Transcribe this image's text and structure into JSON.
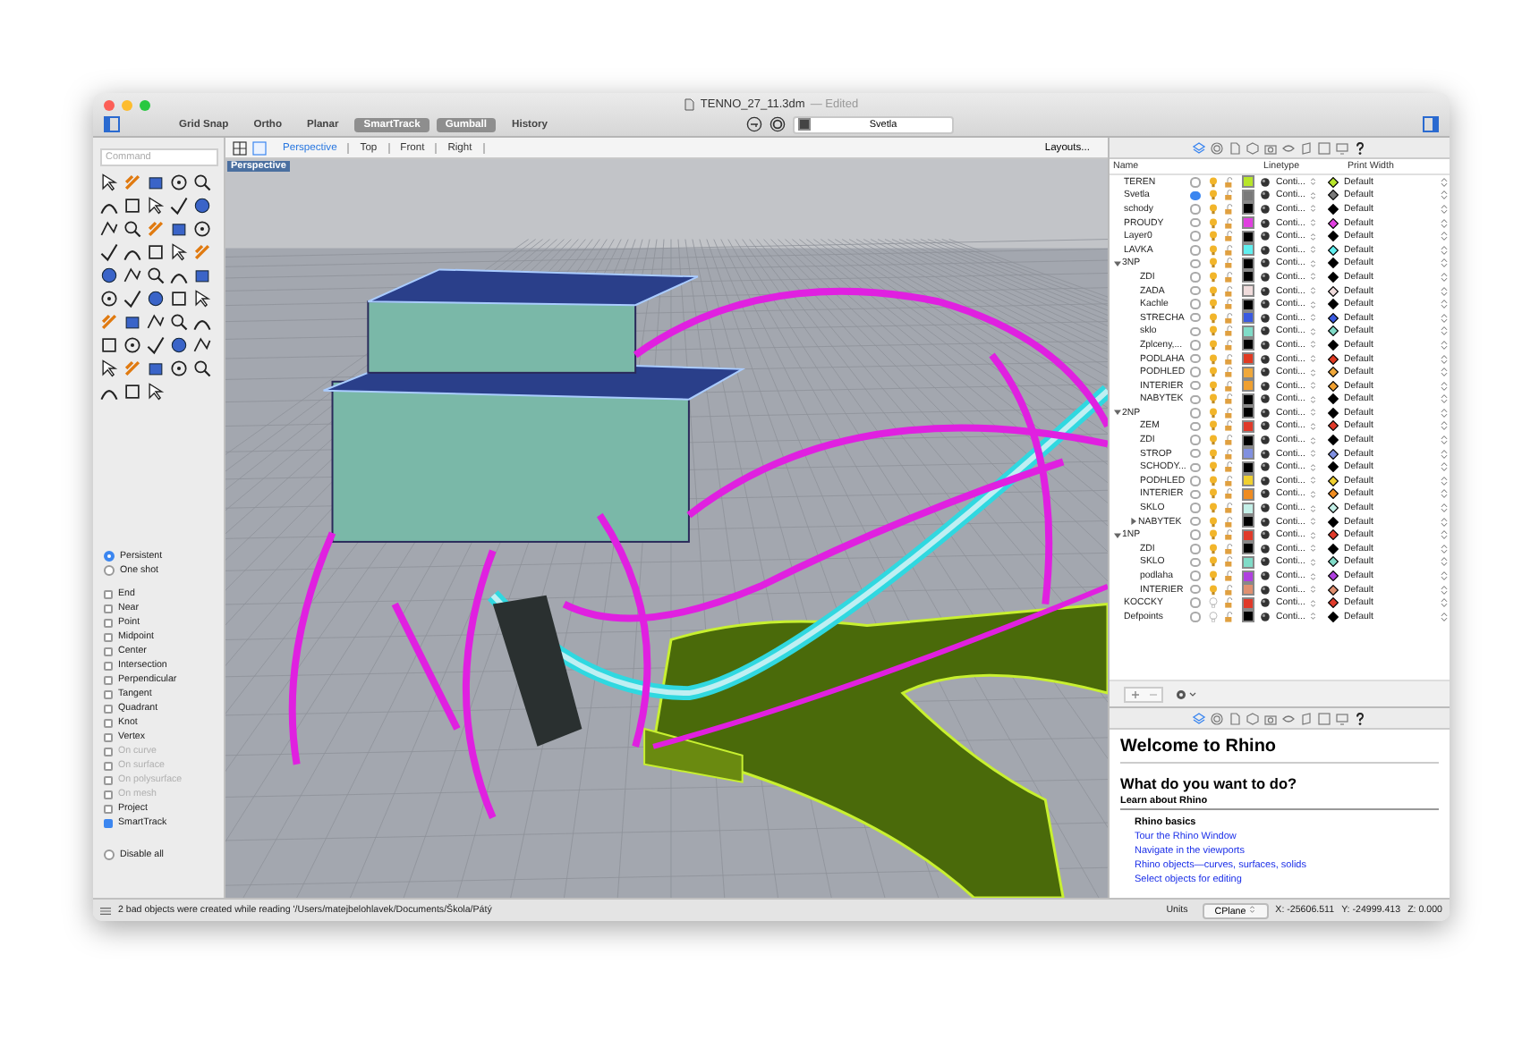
{
  "window": {
    "title": "TENNO_27_11.3dm",
    "subtitle": "— Edited"
  },
  "toolbar": {
    "toggles": [
      {
        "label": "Grid Snap",
        "on": false
      },
      {
        "label": "Ortho",
        "on": false
      },
      {
        "label": "Planar",
        "on": false
      },
      {
        "label": "SmartTrack",
        "on": true
      },
      {
        "label": "Gumball",
        "on": true
      },
      {
        "label": "History",
        "on": false
      }
    ],
    "layer_dropdown": "Svetla"
  },
  "viewport_tabs": {
    "tabs": [
      {
        "label": "Perspective",
        "selected": true
      },
      {
        "label": "Top",
        "selected": false
      },
      {
        "label": "Front",
        "selected": false
      },
      {
        "label": "Right",
        "selected": false
      }
    ],
    "layouts_button": "Layouts..."
  },
  "viewport": {
    "label": "Perspective"
  },
  "command": {
    "placeholder": "Command"
  },
  "snap_mode": [
    {
      "label": "Persistent",
      "selected": true
    },
    {
      "label": "One shot",
      "selected": false
    }
  ],
  "osnaps": [
    {
      "label": "End",
      "checked": false,
      "disabled": false
    },
    {
      "label": "Near",
      "checked": false,
      "disabled": false
    },
    {
      "label": "Point",
      "checked": false,
      "disabled": false
    },
    {
      "label": "Midpoint",
      "checked": false,
      "disabled": false
    },
    {
      "label": "Center",
      "checked": false,
      "disabled": false
    },
    {
      "label": "Intersection",
      "checked": false,
      "disabled": false
    },
    {
      "label": "Perpendicular",
      "checked": false,
      "disabled": false
    },
    {
      "label": "Tangent",
      "checked": false,
      "disabled": false
    },
    {
      "label": "Quadrant",
      "checked": false,
      "disabled": false
    },
    {
      "label": "Knot",
      "checked": false,
      "disabled": false
    },
    {
      "label": "Vertex",
      "checked": false,
      "disabled": false
    },
    {
      "label": "On curve",
      "checked": false,
      "disabled": true
    },
    {
      "label": "On surface",
      "checked": false,
      "disabled": true
    },
    {
      "label": "On polysurface",
      "checked": false,
      "disabled": true
    },
    {
      "label": "On mesh",
      "checked": false,
      "disabled": true
    },
    {
      "label": "Project",
      "checked": false,
      "disabled": false
    },
    {
      "label": "SmartTrack",
      "checked": true,
      "disabled": false
    }
  ],
  "disable_all": {
    "label": "Disable all",
    "checked": false
  },
  "layers": {
    "name_header": "Name",
    "linetype_header": "Linetype",
    "print_width_header": "Print Width",
    "items": [
      {
        "name": "TEREN",
        "current": false,
        "visible": true,
        "color": "#b8e62a",
        "linetype": "Conti...",
        "print_width": "Default"
      },
      {
        "name": "Svetla",
        "current": true,
        "visible": true,
        "color": "#7a7a7a",
        "linetype": "Conti...",
        "print_width": "Default"
      },
      {
        "name": "schody",
        "current": false,
        "visible": true,
        "color": "#000000",
        "linetype": "Conti...",
        "print_width": "Default"
      },
      {
        "name": "PROUDY",
        "current": false,
        "visible": true,
        "color": "#e040e0",
        "linetype": "Conti...",
        "print_width": "Default"
      },
      {
        "name": "Layer0",
        "current": false,
        "visible": true,
        "color": "#000000",
        "linetype": "Conti...",
        "print_width": "Default"
      },
      {
        "name": "LAVKA",
        "current": false,
        "visible": true,
        "color": "#60f0f0",
        "linetype": "Conti...",
        "print_width": "Default"
      },
      {
        "name": "3NP",
        "current": false,
        "visible": true,
        "color": "#000000",
        "linetype": "Conti...",
        "print_width": "Default",
        "expanded": true,
        "children": [
          {
            "name": "ZDI",
            "current": false,
            "visible": true,
            "color": "#000000",
            "linetype": "Conti...",
            "print_width": "Default"
          },
          {
            "name": "ZADA",
            "current": false,
            "visible": true,
            "color": "#f0dcdc",
            "linetype": "Conti...",
            "print_width": "Default"
          },
          {
            "name": "Kachle",
            "current": false,
            "visible": true,
            "color": "#000000",
            "linetype": "Conti...",
            "print_width": "Default"
          },
          {
            "name": "STRECHA",
            "current": false,
            "visible": true,
            "color": "#3a5ae0",
            "linetype": "Conti...",
            "print_width": "Default"
          },
          {
            "name": "sklo",
            "current": false,
            "visible": true,
            "color": "#80dcc8",
            "linetype": "Conti...",
            "print_width": "Default"
          },
          {
            "name": "Zplceny,...",
            "current": false,
            "visible": true,
            "color": "#000000",
            "linetype": "Conti...",
            "print_width": "Default"
          },
          {
            "name": "PODLAHA",
            "current": false,
            "visible": true,
            "color": "#e03a22",
            "linetype": "Conti...",
            "print_width": "Default"
          },
          {
            "name": "PODHLED",
            "current": false,
            "visible": true,
            "color": "#f0a83a",
            "linetype": "Conti...",
            "print_width": "Default"
          },
          {
            "name": "INTERIER",
            "current": false,
            "visible": true,
            "color": "#f0a030",
            "linetype": "Conti...",
            "print_width": "Default"
          },
          {
            "name": "NABYTEK",
            "current": false,
            "visible": true,
            "color": "#000000",
            "linetype": "Conti...",
            "print_width": "Default"
          }
        ]
      },
      {
        "name": "2NP",
        "current": false,
        "visible": true,
        "color": "#000000",
        "linetype": "Conti...",
        "print_width": "Default",
        "expanded": true,
        "children": [
          {
            "name": "ZEM",
            "current": false,
            "visible": true,
            "color": "#e03a2a",
            "linetype": "Conti...",
            "print_width": "Default"
          },
          {
            "name": "ZDI",
            "current": false,
            "visible": true,
            "color": "#000000",
            "linetype": "Conti...",
            "print_width": "Default"
          },
          {
            "name": "STROP",
            "current": false,
            "visible": true,
            "color": "#8090e0",
            "linetype": "Conti...",
            "print_width": "Default"
          },
          {
            "name": "SCHODY...",
            "current": false,
            "visible": true,
            "color": "#000000",
            "linetype": "Conti...",
            "print_width": "Default"
          },
          {
            "name": "PODHLED",
            "current": false,
            "visible": true,
            "color": "#f0d030",
            "linetype": "Conti...",
            "print_width": "Default"
          },
          {
            "name": "INTERIER",
            "current": false,
            "visible": true,
            "color": "#f08c20",
            "linetype": "Conti...",
            "print_width": "Default"
          },
          {
            "name": "SKLO",
            "current": false,
            "visible": true,
            "color": "#c4f0e8",
            "linetype": "Conti...",
            "print_width": "Default"
          },
          {
            "name": "NABYTEK",
            "current": false,
            "visible": true,
            "color": "#000000",
            "linetype": "Conti...",
            "print_width": "Default",
            "expanded": false
          }
        ]
      },
      {
        "name": "1NP",
        "current": false,
        "visible": true,
        "color": "#e03a2a",
        "linetype": "Conti...",
        "print_width": "Default",
        "expanded": true,
        "children": [
          {
            "name": "ZDI",
            "current": false,
            "visible": true,
            "color": "#000000",
            "linetype": "Conti...",
            "print_width": "Default"
          },
          {
            "name": "SKLO",
            "current": false,
            "visible": true,
            "color": "#80dcc8",
            "linetype": "Conti...",
            "print_width": "Default"
          },
          {
            "name": "podlaha",
            "current": false,
            "visible": true,
            "color": "#b040e0",
            "linetype": "Conti...",
            "print_width": "Default"
          },
          {
            "name": "INTERIER",
            "current": false,
            "visible": true,
            "color": "#e09070",
            "linetype": "Conti...",
            "print_width": "Default"
          }
        ]
      },
      {
        "name": "KOCCKY",
        "current": false,
        "visible": false,
        "color": "#e03a2a",
        "linetype": "Conti...",
        "print_width": "Default"
      },
      {
        "name": "Defpoints",
        "current": false,
        "visible": false,
        "color": "#000000",
        "linetype": "Conti...",
        "print_width": "Default"
      }
    ]
  },
  "welcome": {
    "title": "Welcome to Rhino",
    "heading": "What do you want to do?",
    "section": "Learn about Rhino",
    "subsection": "Rhino basics",
    "links": [
      "Tour the Rhino Window",
      "Navigate in the viewports",
      "Rhino objects—curves, surfaces, solids",
      "Select objects for editing"
    ]
  },
  "status_bar": {
    "message": "2 bad objects were created while reading '/Users/matejbelohlavek/Documents/Škola/Pátý",
    "units_label": "Units",
    "cplane": "CPlane",
    "x": "X: -25606.511",
    "y": "Y: -24999.413",
    "z": "Z: 0.000"
  }
}
